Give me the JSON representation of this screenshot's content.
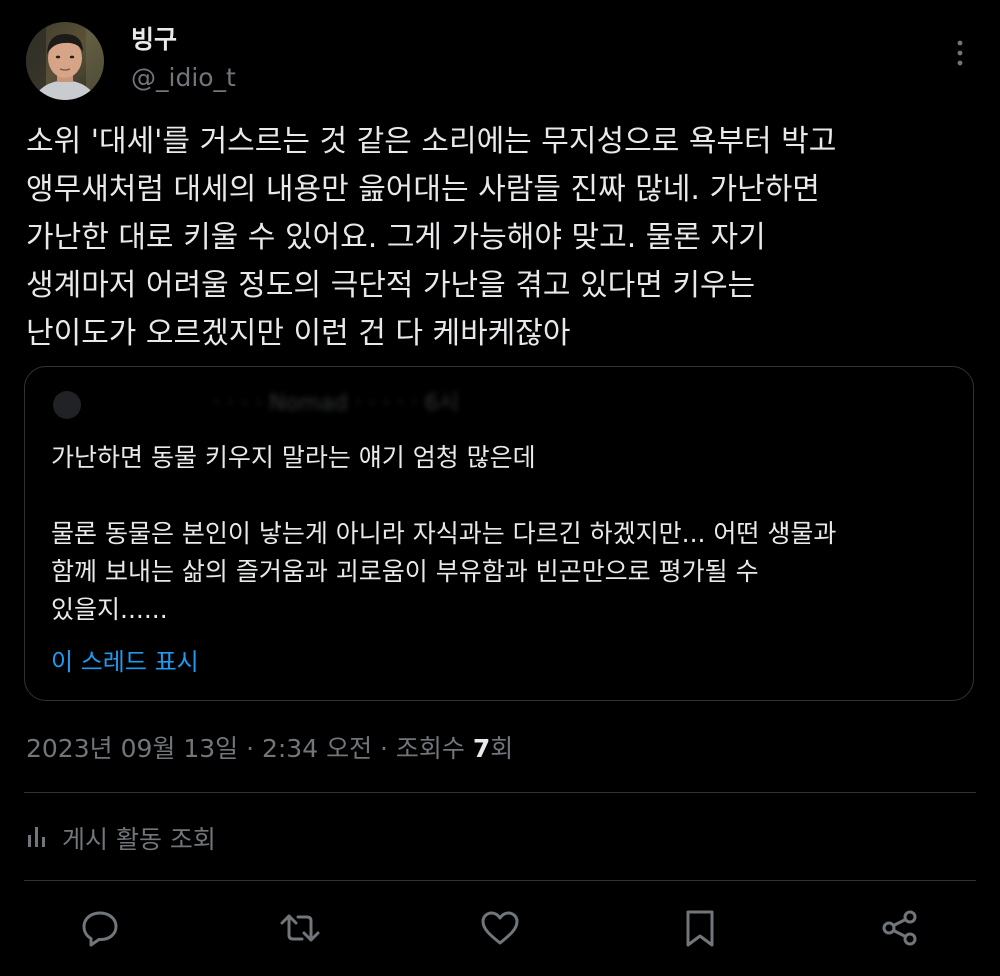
{
  "author": {
    "display_name": "빙구",
    "handle": "@_idio_t"
  },
  "tweet": {
    "lines": [
      "소위 '대세'를 거스르는 것 같은 소리에는 무지성으로 욕부터 박고",
      "앵무새처럼 대세의 내용만 읊어대는 사람들 진짜 많네. 가난하면",
      "가난한 대로 키울 수 있어요. 그게 가능해야 맞고. 물론 자기",
      "생계마저 어려울 정도의 극단적 가난을 겪고 있다면 키우는",
      "난이도가 오르겠지만 이런 건 다 케바케잖아"
    ]
  },
  "quote": {
    "header_obscured": "· · · · Nomad · · · · · 6시",
    "lines": [
      "가난하면 동물 키우지 말라는 얘기 엄청 많은데",
      "",
      "물론 동물은 본인이 낳는게 아니라 자식과는 다르긴 하겠지만... 어떤 생물과",
      "함께 보내는 삶의 즐거움과 괴로움이 부유함과 빈곤만으로 평가될 수",
      "있을지......"
    ],
    "show_thread": "이 스레드 표시"
  },
  "meta": {
    "timestamp": "2023년 09월 13일 · 2:34 오전 · 조회수 ",
    "views": "7",
    "views_suffix": "회"
  },
  "activity": {
    "label": "게시 활동 조회"
  },
  "icons": {
    "more": "more-vertical-icon",
    "reply": "reply-icon",
    "retweet": "retweet-icon",
    "like": "heart-icon",
    "bookmark": "bookmark-icon",
    "share": "share-icon",
    "activity": "bar-chart-icon"
  },
  "colors": {
    "background": "#000000",
    "text": "#e7e9ea",
    "muted": "#71767b",
    "link": "#1d9bf0",
    "border": "#2f3336"
  }
}
